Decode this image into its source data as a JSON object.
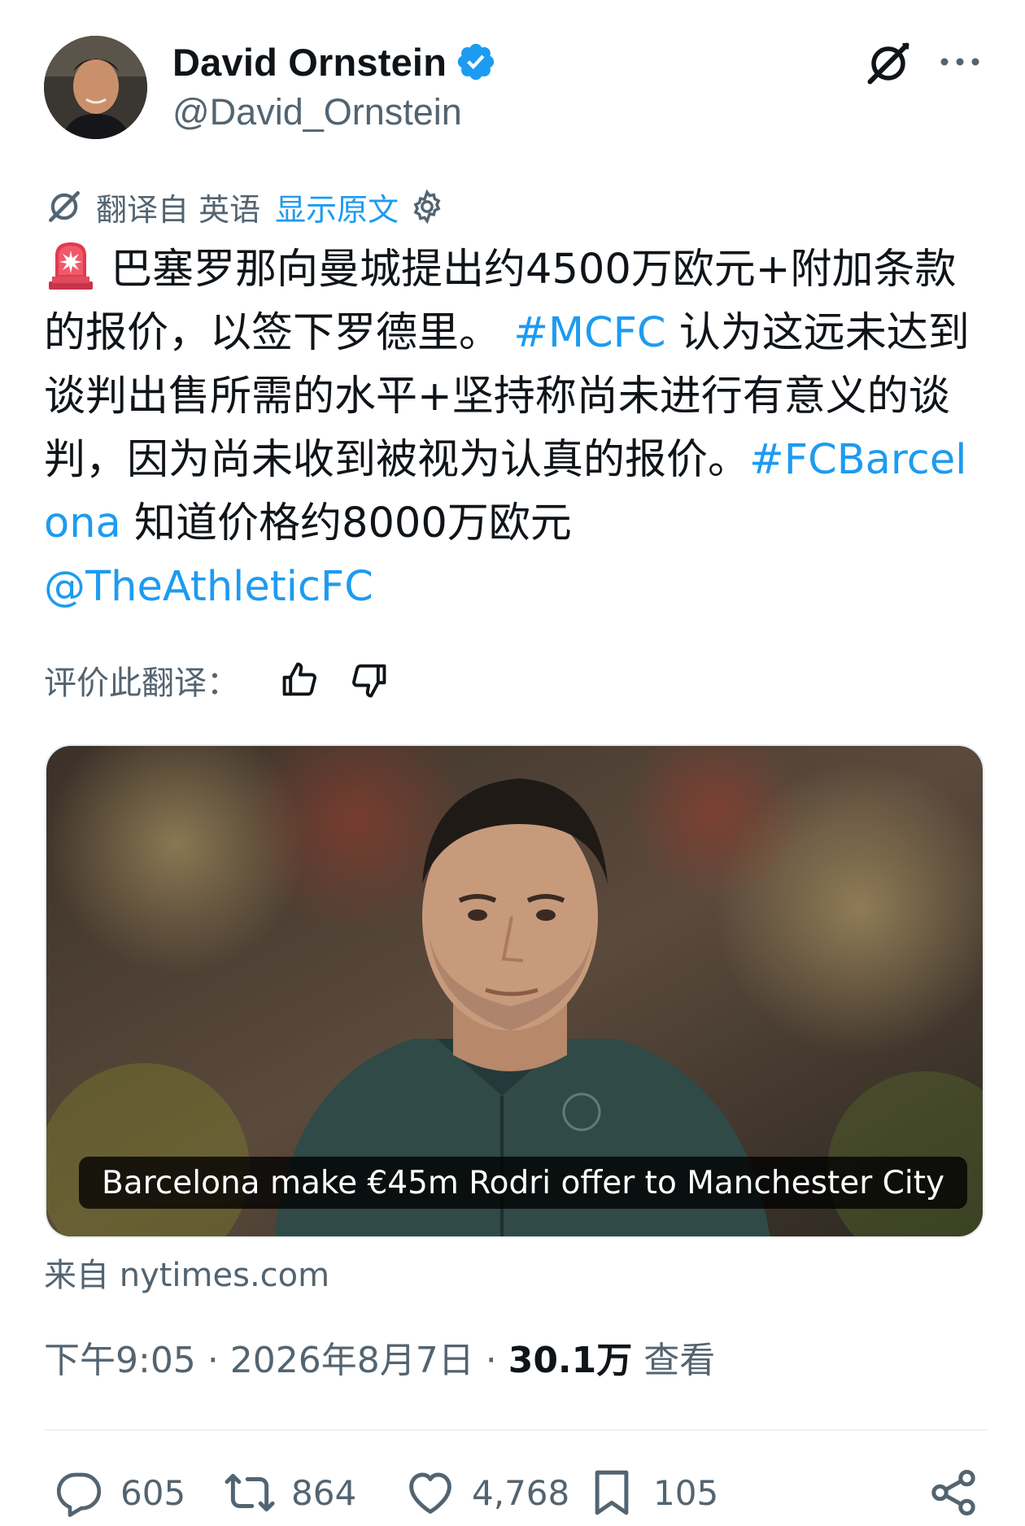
{
  "author": {
    "name": "David Ornstein",
    "handle": "@David_Ornstein"
  },
  "translation": {
    "from_label": "翻译自 英语",
    "show_original": "显示原文"
  },
  "tweet": {
    "seg1": "巴塞罗那向曼城提出约4500万欧元+附加条款的报价，以签下罗德里。",
    "hashtag1": "#MCFC",
    "seg2": " 认为这远未达到谈判出售所需的水平+坚持称尚未进行有意义的谈判，因为尚未收到被视为认真的报价。",
    "hashtag2": "#FCBarcelona",
    "seg3": " 知道价格约8000万欧元",
    "mention": "@TheAthleticFC"
  },
  "rate": {
    "label": "评价此翻译："
  },
  "card": {
    "caption": "Barcelona make €45m Rodri offer to Manchester City",
    "source": "来自 nytimes.com"
  },
  "meta": {
    "time_date": "下午9:05 · 2026年8月7日 · ",
    "views_count": "30.1万",
    "views_label": " 查看"
  },
  "actions": {
    "replies": "605",
    "reposts": "864",
    "likes": "4,768",
    "bookmarks": "105"
  },
  "colors": {
    "link": "#1d9bf0",
    "secondary_text": "#536471",
    "primary_text": "#0f1419"
  }
}
